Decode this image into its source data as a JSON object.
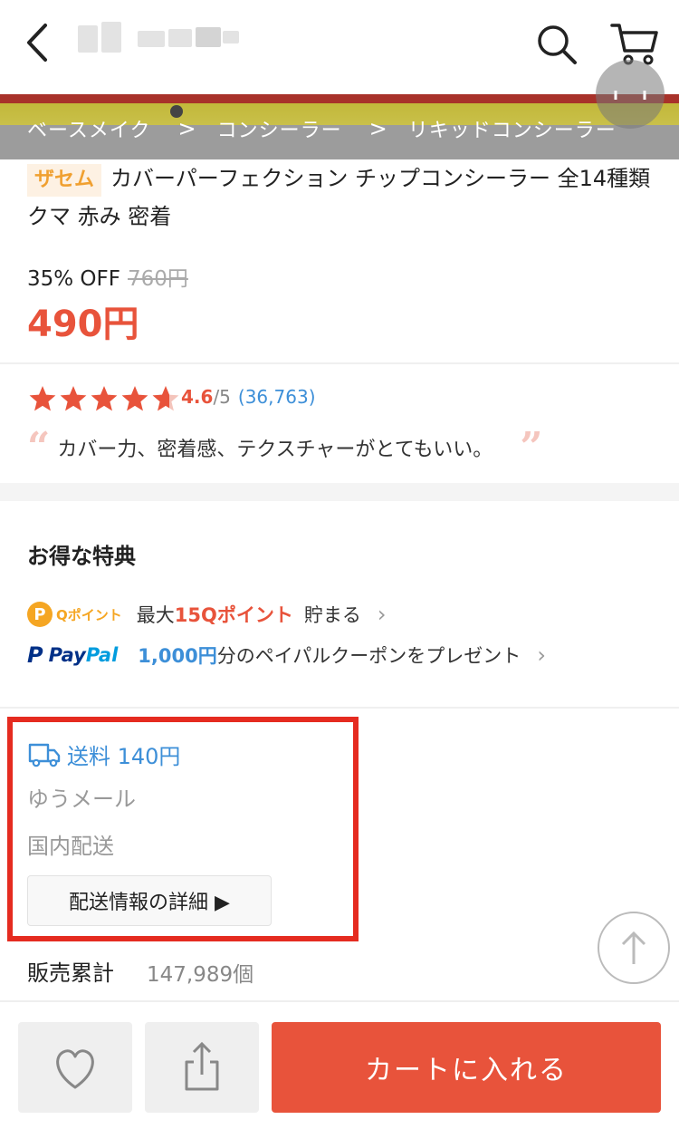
{
  "header": {
    "back_icon": "chevron-left-icon",
    "search_icon": "search-icon",
    "cart_icon": "cart-icon"
  },
  "breadcrumb": {
    "items": [
      "ベースメイク",
      "コンシーラー",
      "リキッドコンシーラー"
    ],
    "separator": ">"
  },
  "product": {
    "brand": "ザセム",
    "title": "カバーパーフェクション チップコンシーラー 全14種類 クマ 赤み 密着",
    "discount": "35% OFF",
    "original_price": "760円",
    "sale_price": "490円"
  },
  "rating": {
    "score": "4.6",
    "max": "/5",
    "count": "(36,763)",
    "stars": 4.6,
    "review_quote": "カバー力、密着感、テクスチャーがとてもいい。",
    "open_quote": "“",
    "close_quote": "”"
  },
  "benefits": {
    "title": "お得な特典",
    "qpoint": {
      "badge_letter": "P",
      "badge_label": "Qポイント",
      "prefix": "最大",
      "highlight": "15Qポイント",
      "suffix": "貯まる"
    },
    "paypal": {
      "logo_p": "P",
      "logo_pay": "Pay",
      "logo_pal": "Pal",
      "highlight": "1,000円",
      "suffix": "分のペイパルクーポンをプレゼント"
    },
    "chevron": "›"
  },
  "shipping": {
    "fee": "送料 140円",
    "method": "ゆうメール",
    "area": "国内配送",
    "detail_button": "配送情報の詳細 ▶"
  },
  "sales": {
    "label": "販売累計",
    "count": "147,989個"
  },
  "bottom_bar": {
    "wish_icon": "heart-icon",
    "share_icon": "share-icon",
    "add_to_cart": "カートに入れる"
  },
  "colors": {
    "accent": "#e8533b",
    "link_blue": "#3d8fd8",
    "highlight_border": "#e52b20",
    "brand_tag": "#f0a030"
  }
}
